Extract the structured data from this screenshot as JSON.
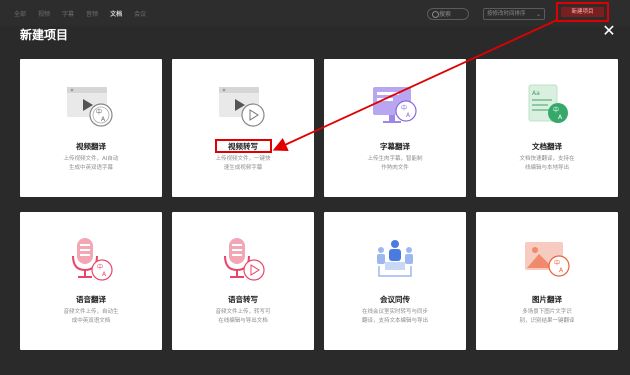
{
  "topbar": {
    "tabs": [
      "全部",
      "视频",
      "字幕",
      "音频",
      "文档",
      "会议"
    ],
    "active_tab_index": 4,
    "search_label": "搜索",
    "sort_label": "按修改时间排序",
    "new_project_label": "新建项目"
  },
  "modal": {
    "title": "新建项目",
    "close_icon": "✕",
    "cards": [
      {
        "title": "视频翻译",
        "desc": [
          "上传视频文件，AI自动",
          "生成中英双语字幕"
        ],
        "icon": "video-translate-icon"
      },
      {
        "title": "视频转写",
        "desc": [
          "上传视频文件，一键快",
          "速生成视频字幕"
        ],
        "icon": "video-transcribe-icon"
      },
      {
        "title": "字幕翻译",
        "desc": [
          "上传生肉字幕，智能制",
          "作熟肉文件"
        ],
        "icon": "subtitle-translate-icon"
      },
      {
        "title": "文档翻译",
        "desc": [
          "文档快速翻译，支持在",
          "线编辑与本地导出"
        ],
        "icon": "document-translate-icon"
      },
      {
        "title": "语音翻译",
        "desc": [
          "音频文件上传，自动生",
          "成中英双语文档"
        ],
        "icon": "audio-translate-icon"
      },
      {
        "title": "语音转写",
        "desc": [
          "音频文件上传，转写可",
          "在线编辑与导出文档"
        ],
        "icon": "audio-transcribe-icon"
      },
      {
        "title": "会议同传",
        "desc": [
          "在线会议室实时转写与同步",
          "翻译，支持文本编辑与导出"
        ],
        "icon": "meeting-interpret-icon"
      },
      {
        "title": "图片翻译",
        "desc": [
          "多场景下图片文字识",
          "别，识别结果一键翻译"
        ],
        "icon": "image-translate-icon"
      }
    ]
  },
  "colors": {
    "highlight": "#e00000",
    "badge": "#e8456a",
    "accent_green": "#35a86a",
    "accent_purple": "#8a6ae0"
  }
}
